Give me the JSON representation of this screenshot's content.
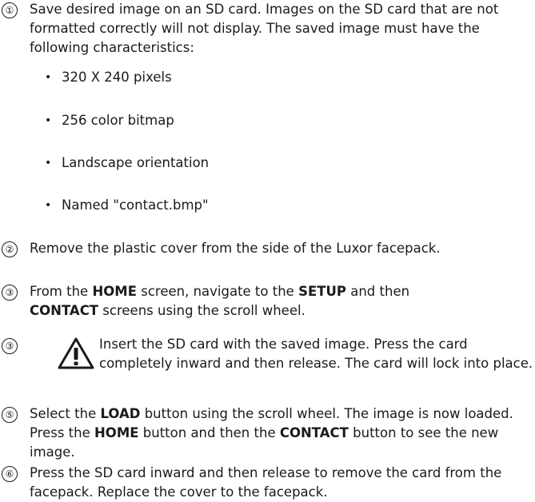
{
  "steps": {
    "s1": {
      "marker": "①",
      "text": "Save desired image on an SD card. Images on the SD card that are not formatted correctly will not display. The saved image must have the following characteristics:",
      "bullets": [
        "320 X 240 pixels",
        "256 color bitmap",
        "Landscape orientation",
        "Named \"contact.bmp\""
      ]
    },
    "s2": {
      "marker": "②",
      "text": "Remove the plastic cover from the side of the Luxor facepack."
    },
    "s3": {
      "marker": "③",
      "p1": "From the ",
      "b1": "HOME",
      "p2": " screen, navigate to the ",
      "b2": "SETUP",
      "p3": " and then ",
      "b3": "CONTACT",
      "p4": " screens using the scroll wheel."
    },
    "s4": {
      "marker": "③",
      "icon": "warning-triangle-icon",
      "text": "Insert the SD card with the saved image. Press the card completely inward and then release. The card will lock into place."
    },
    "s5": {
      "marker": "⑤",
      "p1": "Select the ",
      "b1": "LOAD",
      "p2": " button using the scroll wheel. The image is now loaded. Press the ",
      "b2": "HOME",
      "p3": " button and then the ",
      "b3": "CONTACT",
      "p4": " button to see the new image."
    },
    "s6": {
      "marker": "⑥",
      "text": "Press the SD card inward and then release to remove the card from the facepack. Replace the cover to the facepack."
    },
    "bullet_glyph": "•"
  }
}
